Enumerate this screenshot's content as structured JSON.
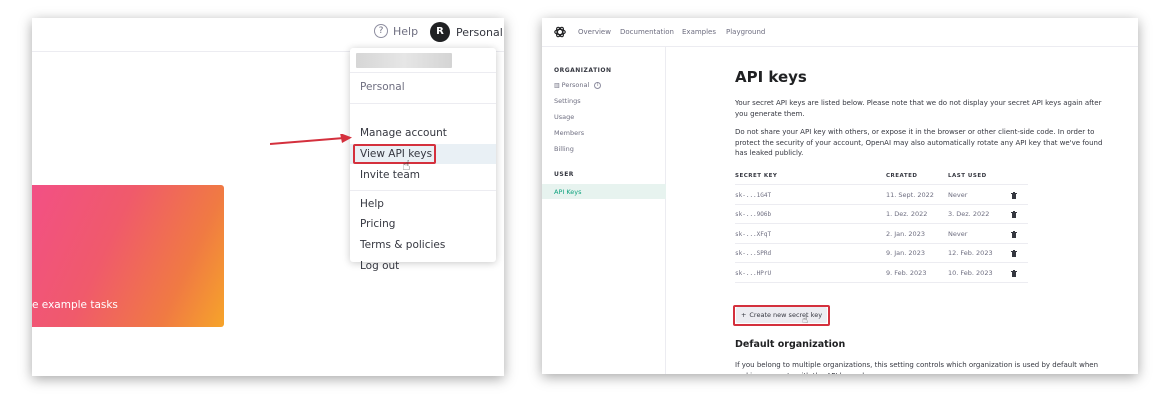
{
  "left": {
    "header": {
      "help_label": "Help",
      "help_icon": "?",
      "avatar_initial": "R",
      "account_label": "Personal"
    },
    "menu": {
      "org_name": "Personal",
      "items_group1": [
        "Manage account",
        "View API keys",
        "Invite team"
      ],
      "items_group2": [
        "Help",
        "Pricing",
        "Terms & policies",
        "Log out"
      ]
    },
    "card": {
      "label": "e example tasks"
    },
    "colors": {
      "highlight": "#d4303d",
      "avatar": "#202123"
    }
  },
  "right": {
    "nav": {
      "links": [
        "Overview",
        "Documentation",
        "Examples",
        "Playground"
      ]
    },
    "sidebar": {
      "org_heading": "ORGANIZATION",
      "org_items": [
        "Personal",
        "Settings",
        "Usage",
        "Members",
        "Billing"
      ],
      "user_heading": "USER",
      "user_items": [
        "API Keys"
      ]
    },
    "main": {
      "title": "API keys",
      "intro_1": "Your secret API keys are listed below. Please note that we do not display your secret API keys again after you generate them.",
      "intro_2": "Do not share your API key with others, or expose it in the browser or other client-side code. In order to protect the security of your account, OpenAI may also automatically rotate any API key that we've found has leaked publicly.",
      "table": {
        "headers": [
          "SECRET KEY",
          "CREATED",
          "LAST USED"
        ],
        "rows": [
          [
            "sk-...1G4T",
            "11. Sept. 2022",
            "Never"
          ],
          [
            "sk-...9O6b",
            "1. Dez. 2022",
            "3. Dez. 2022"
          ],
          [
            "sk-...XFqT",
            "2. Jan. 2023",
            "Never"
          ],
          [
            "sk-...SPRd",
            "9. Jan. 2023",
            "12. Feb. 2023"
          ],
          [
            "sk-...HPrU",
            "9. Feb. 2023",
            "10. Feb. 2023"
          ]
        ]
      },
      "create_button": "Create new secret key",
      "create_button_icon": "+",
      "default_org_title": "Default organization",
      "default_org_text": "If you belong to multiple organizations, this setting controls which organization is used by default when making requests with the API keys above."
    },
    "colors": {
      "active_sidebar": "#e7f3ef",
      "button_bg": "#ececf1"
    }
  }
}
